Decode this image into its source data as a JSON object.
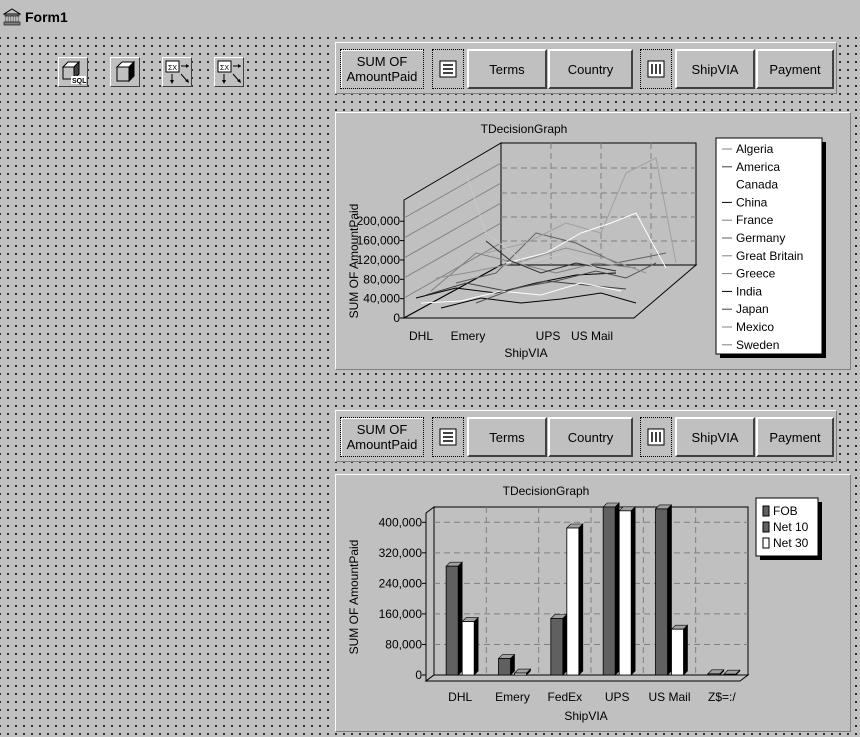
{
  "window": {
    "title": "Form1"
  },
  "tools": [
    "sql-query-icon",
    "decision-cube-icon",
    "decision-source-icon",
    "decision-pivot-icon"
  ],
  "pivot": {
    "sum_label": "SUM OF AmountPaid",
    "sum_line1": "SUM OF",
    "sum_line2": "AmountPaid",
    "buttons": [
      "Terms",
      "Country",
      "ShipVIA",
      "Payment"
    ]
  },
  "graph1": {
    "title": "TDecisionGraph",
    "ylabel": "SUM OF AmountPaid",
    "xlabel": "ShipVIA",
    "yticks": [
      "0",
      "40,000",
      "80,000",
      "120,000",
      "160,000",
      "200,000"
    ],
    "xticks": [
      "DHL",
      "Emery",
      "UPS",
      "US Mail"
    ],
    "legend": [
      "Algeria",
      "America",
      "Canada",
      "China",
      "France",
      "Germany",
      "Great Britain",
      "Greece",
      "India",
      "Japan",
      "Mexico",
      "Sweden"
    ]
  },
  "graph2": {
    "title": "TDecisionGraph",
    "ylabel": "SUM OF AmountPaid",
    "xlabel": "ShipVIA",
    "yticks": [
      "0",
      "80,000",
      "160,000",
      "240,000",
      "320,000",
      "400,000"
    ],
    "legend": [
      "FOB",
      "Net 10",
      "Net 30"
    ]
  },
  "chart_data": [
    {
      "type": "line",
      "title": "TDecisionGraph",
      "xlabel": "ShipVIA",
      "ylabel": "SUM OF AmountPaid",
      "categories": [
        "DHL",
        "Emery",
        "UPS",
        "US Mail"
      ],
      "ylim": [
        0,
        200000
      ],
      "legend": [
        "Algeria",
        "America",
        "Canada",
        "China",
        "France",
        "Germany",
        "Great Britain",
        "Greece",
        "India",
        "Japan",
        "Mexico",
        "Sweden"
      ],
      "legend_position": "right",
      "grid": true
    },
    {
      "type": "bar",
      "title": "TDecisionGraph",
      "xlabel": "ShipVIA",
      "ylabel": "SUM OF AmountPaid",
      "categories": [
        "DHL",
        "Emery",
        "FedEx",
        "UPS",
        "US Mail",
        "Z$=:/"
      ],
      "ylim": [
        0,
        440000
      ],
      "legend_position": "top-right",
      "grid": true,
      "series": [
        {
          "name": "FOB",
          "color": "#606060",
          "values": [
            0,
            0,
            0,
            0,
            0,
            0
          ]
        },
        {
          "name": "Net 10",
          "color": "#606060",
          "values": [
            285000,
            43000,
            148000,
            440000,
            435000,
            3000
          ]
        },
        {
          "name": "Net 30",
          "color": "#ffffff",
          "values": [
            140000,
            5000,
            385000,
            430000,
            120000,
            2000
          ]
        }
      ]
    }
  ]
}
